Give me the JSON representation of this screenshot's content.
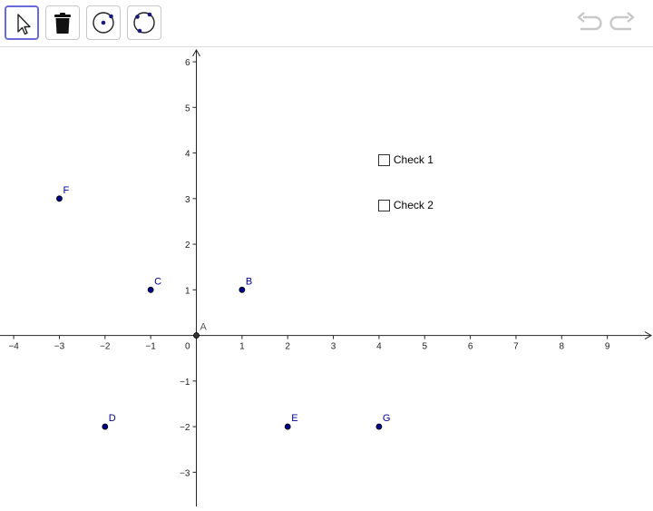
{
  "toolbar": {
    "tools": [
      {
        "name": "move-tool",
        "icon": "arrow-pointer-icon",
        "active": true
      },
      {
        "name": "delete-tool",
        "icon": "trash-icon",
        "active": false
      },
      {
        "name": "circle-center-point-tool",
        "icon": "circle-center-point-icon",
        "active": false
      },
      {
        "name": "circle-three-points-tool",
        "icon": "circle-three-points-icon",
        "active": false
      }
    ],
    "undo_icon": "undo-icon",
    "redo_icon": "redo-icon"
  },
  "graph": {
    "x_range": [
      -4.3,
      10
    ],
    "y_range": [
      -3.75,
      6.3
    ],
    "x_ticks": [
      -4,
      -3,
      -2,
      -1,
      1,
      2,
      3,
      4,
      5,
      6,
      7,
      8,
      9
    ],
    "y_ticks": [
      -3,
      -2,
      -1,
      1,
      2,
      3,
      4,
      5,
      6
    ],
    "origin_label": "0",
    "point_color": "#00008b",
    "axis_point_color": "#333333",
    "points": [
      {
        "label": "A",
        "x": 0,
        "y": 0,
        "on_axis": true
      },
      {
        "label": "B",
        "x": 1,
        "y": 1
      },
      {
        "label": "C",
        "x": -1,
        "y": 1
      },
      {
        "label": "D",
        "x": -2,
        "y": -2
      },
      {
        "label": "E",
        "x": 2,
        "y": -2
      },
      {
        "label": "F",
        "x": -3,
        "y": 3
      },
      {
        "label": "G",
        "x": 4,
        "y": -2
      }
    ]
  },
  "checkboxes": [
    {
      "label": "Check 1",
      "checked": false,
      "x": 4,
      "y": 3.85
    },
    {
      "label": "Check 2",
      "checked": false,
      "x": 4,
      "y": 2.85
    }
  ]
}
